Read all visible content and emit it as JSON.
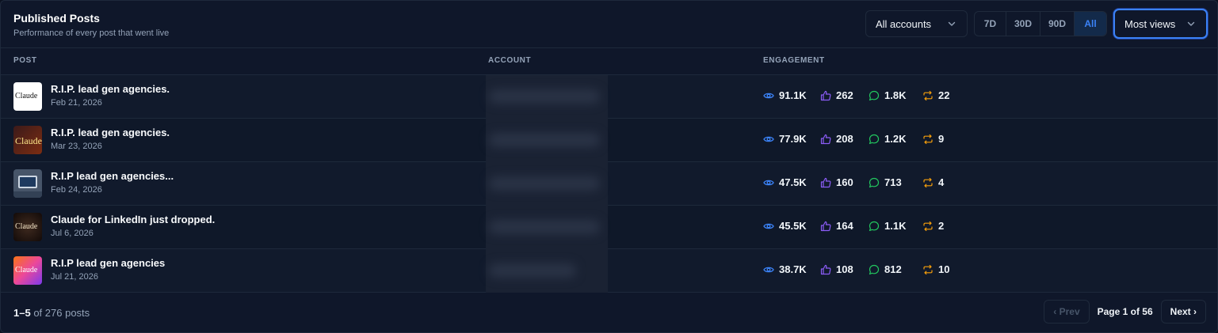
{
  "header": {
    "title": "Published Posts",
    "subtitle": "Performance of every post that went live"
  },
  "controls": {
    "account_filter": "All accounts",
    "ranges": [
      "7D",
      "30D",
      "90D",
      "All"
    ],
    "active_range": "All",
    "sort": "Most views"
  },
  "columns": {
    "post": "POST",
    "account": "ACCOUNT",
    "engagement": "ENGAGEMENT"
  },
  "posts": [
    {
      "title": "R.I.P. lead gen agencies.",
      "date": "Feb 21, 2026",
      "thumb_label": "Claude",
      "views": "91.1K",
      "likes": "262",
      "comments": "1.8K",
      "reposts": "22"
    },
    {
      "title": "R.I.P. lead gen agencies.",
      "date": "Mar 23, 2026",
      "thumb_label": "Claude",
      "views": "77.9K",
      "likes": "208",
      "comments": "1.2K",
      "reposts": "9"
    },
    {
      "title": "R.I.P lead gen agencies...",
      "date": "Feb 24, 2026",
      "thumb_label": "",
      "views": "47.5K",
      "likes": "160",
      "comments": "713",
      "reposts": "4"
    },
    {
      "title": "Claude for LinkedIn just dropped.",
      "date": "Jul 6, 2026",
      "thumb_label": "Claude",
      "views": "45.5K",
      "likes": "164",
      "comments": "1.1K",
      "reposts": "2"
    },
    {
      "title": "R.I.P lead gen agencies",
      "date": "Jul 21, 2026",
      "thumb_label": "Claude",
      "views": "38.7K",
      "likes": "108",
      "comments": "812",
      "reposts": "10"
    }
  ],
  "footer": {
    "range_text": "1–5",
    "of_text": "of 276 posts",
    "prev_label": "‹ Prev",
    "page_info": "Page 1 of 56",
    "next_label": "Next ›"
  },
  "colors": {
    "accent": "#3b82f6",
    "views_icon": "#3b82f6",
    "likes_icon": "#8b5cf6",
    "comments_icon": "#22c55e",
    "reposts_icon": "#f59e0b"
  },
  "icons": [
    "chevron-down-icon",
    "eye-icon",
    "thumbs-up-icon",
    "comment-icon",
    "repost-icon"
  ]
}
